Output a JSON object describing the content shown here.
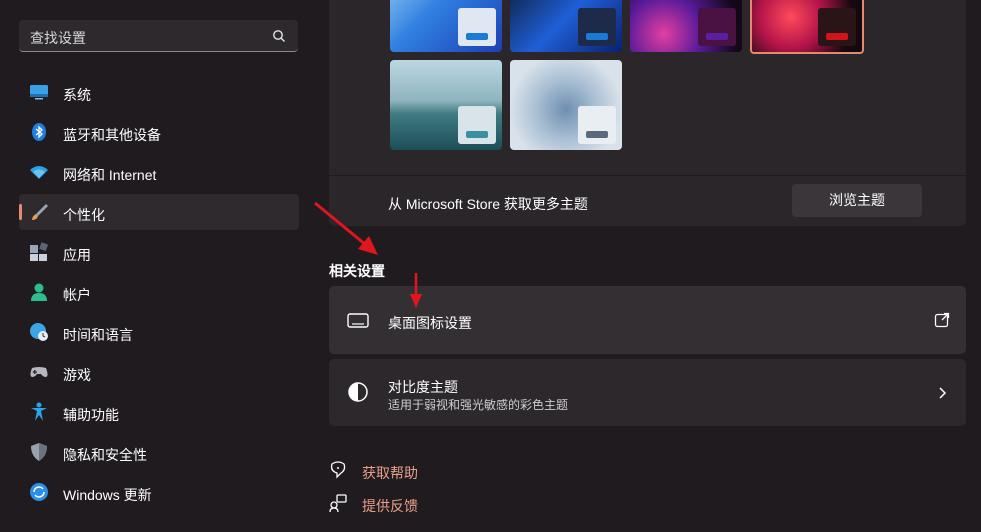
{
  "search": {
    "placeholder": "查找设置"
  },
  "nav": [
    {
      "label": "系统",
      "icon": "monitor-icon",
      "color": "#3aa0e8"
    },
    {
      "label": "蓝牙和其他设备",
      "icon": "bluetooth-icon",
      "color": "#1f7fe0"
    },
    {
      "label": "网络和 Internet",
      "icon": "wifi-icon",
      "color": "#2ea0e6"
    },
    {
      "label": "个性化",
      "icon": "brush-icon",
      "color": "#e0a050",
      "active": true
    },
    {
      "label": "应用",
      "icon": "apps-icon",
      "color": "#9aa6b8"
    },
    {
      "label": "帐户",
      "icon": "account-icon",
      "color": "#2ebd8e"
    },
    {
      "label": "时间和语言",
      "icon": "globe-clock-icon",
      "color": "#3aa6e8"
    },
    {
      "label": "游戏",
      "icon": "gamepad-icon",
      "color": "#b7b7bf"
    },
    {
      "label": "辅助功能",
      "icon": "accessibility-icon",
      "color": "#2aa6ea"
    },
    {
      "label": "隐私和安全性",
      "icon": "shield-icon",
      "color": "#9aa2ad"
    },
    {
      "label": "Windows 更新",
      "icon": "update-icon",
      "color": "#2a8fe8"
    }
  ],
  "themes": {
    "store_text": "从 Microsoft Store 获取更多主题",
    "browse_button": "浏览主题",
    "accent": "#e58a71"
  },
  "related": {
    "title": "相关设置",
    "desktop_icons": {
      "title": "桌面图标设置",
      "icon": "monitor-outline-icon",
      "action_icon": "open-external-icon"
    },
    "contrast": {
      "title": "对比度主题",
      "subtitle": "适用于弱视和强光敏感的彩色主题",
      "icon": "contrast-icon",
      "action_icon": "chevron-right-icon"
    }
  },
  "help_links": [
    {
      "label": "获取帮助",
      "icon": "help-icon"
    },
    {
      "label": "提供反馈",
      "icon": "feedback-icon"
    }
  ]
}
